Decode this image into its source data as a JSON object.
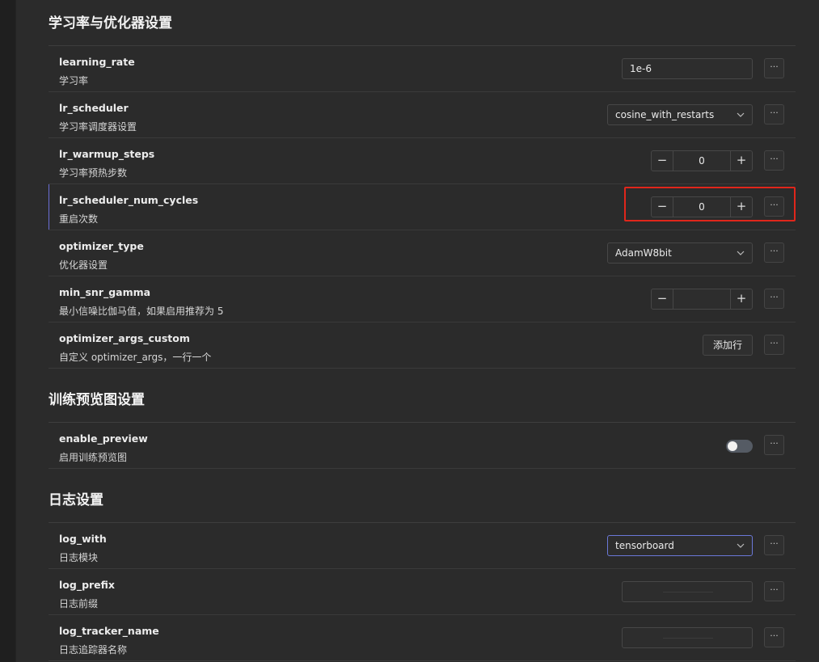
{
  "sections": [
    {
      "title": "学习率与优化器设置",
      "rows": [
        {
          "name": "learning_rate",
          "desc": "学习率",
          "control": "text",
          "value": "1e-6"
        },
        {
          "name": "lr_scheduler",
          "desc": "学习率调度器设置",
          "control": "select",
          "value": "cosine_with_restarts"
        },
        {
          "name": "lr_warmup_steps",
          "desc": "学习率预热步数",
          "control": "stepper",
          "value": "0"
        },
        {
          "name": "lr_scheduler_num_cycles",
          "desc": "重启次数",
          "control": "stepper",
          "value": "0"
        },
        {
          "name": "optimizer_type",
          "desc": "优化器设置",
          "control": "select",
          "value": "AdamW8bit"
        },
        {
          "name": "min_snr_gamma",
          "desc": "最小信噪比伽马值，如果启用推荐为 5",
          "control": "stepper",
          "value": ""
        },
        {
          "name": "optimizer_args_custom",
          "desc": "自定义 optimizer_args，一行一个",
          "control": "button",
          "value": "添加行"
        }
      ]
    },
    {
      "title": "训练预览图设置",
      "rows": [
        {
          "name": "enable_preview",
          "desc": "启用训练预览图",
          "control": "toggle",
          "value": "off"
        }
      ]
    },
    {
      "title": "日志设置",
      "rows": [
        {
          "name": "log_with",
          "desc": "日志模块",
          "control": "select",
          "value": "tensorboard"
        },
        {
          "name": "log_prefix",
          "desc": "日志前缀",
          "control": "text",
          "value": ""
        },
        {
          "name": "log_tracker_name",
          "desc": "日志追踪器名称",
          "control": "text",
          "value": ""
        }
      ]
    }
  ],
  "stepper": {
    "minus": "−",
    "plus": "+"
  },
  "more_label": "···",
  "colors": {
    "accent": "#6b78d8",
    "highlight": "#e0261b",
    "background": "#2b2b2b"
  }
}
